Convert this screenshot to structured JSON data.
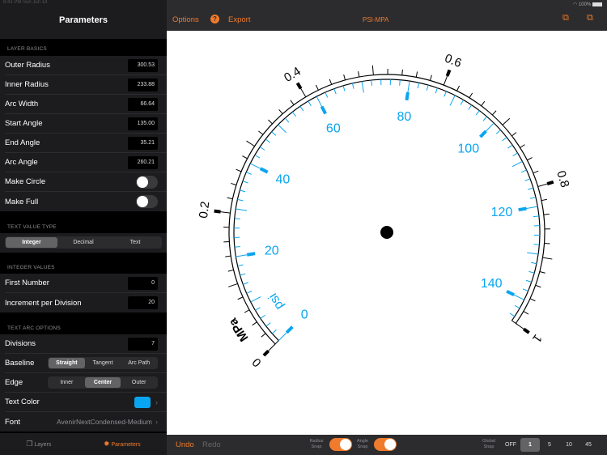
{
  "status": {
    "time": "8:41 PM  Sun Jun 14",
    "battery": "100%"
  },
  "sidebar": {
    "title": "Parameters",
    "layer_basics": {
      "header": "LAYER BASICS",
      "rows": [
        {
          "label": "Outer Radius",
          "value": "300.53"
        },
        {
          "label": "Inner Radius",
          "value": "233.88"
        },
        {
          "label": "Arc Width",
          "value": "66.64"
        },
        {
          "label": "Start Angle",
          "value": "135.00"
        },
        {
          "label": "End Angle",
          "value": "35.21"
        },
        {
          "label": "Arc Angle",
          "value": "260.21"
        }
      ],
      "make_circle": {
        "label": "Make Circle",
        "on": false
      },
      "make_full": {
        "label": "Make Full",
        "on": false
      }
    },
    "text_value_type": {
      "header": "TEXT VALUE TYPE",
      "options": [
        "Integer",
        "Decimal",
        "Text"
      ],
      "selected": "Integer"
    },
    "integer_values": {
      "header": "INTEGER VALUES",
      "rows": [
        {
          "label": "First Number",
          "value": "0"
        },
        {
          "label": "Increment per Division",
          "value": "20"
        }
      ]
    },
    "text_arc_options": {
      "header": "TEXT ARC OPTIONS",
      "divisions": {
        "label": "Divisions",
        "value": "7"
      },
      "baseline": {
        "label": "Baseline",
        "options": [
          "Straight",
          "Tangent",
          "Arc Path"
        ],
        "selected": "Straight"
      },
      "edge": {
        "label": "Edge",
        "options": [
          "Inner",
          "Center",
          "Outer"
        ],
        "selected": "Center"
      },
      "text_color": {
        "label": "Text Color",
        "color": "#0aa5f0"
      },
      "font": {
        "label": "Font",
        "value": "AvenirNextCondensed-Medium"
      }
    },
    "tabs": [
      {
        "label": "Layers",
        "icon": "layers-icon"
      },
      {
        "label": "Parameters",
        "icon": "gear-icon",
        "active": true
      }
    ]
  },
  "toolbar": {
    "options": "Options",
    "help": "?",
    "export": "Export",
    "title": "PSI-MPA"
  },
  "bottom": {
    "undo": "Undo",
    "redo": "Redo",
    "radius_snap": "Radius Snap",
    "angle_snap": "Angle Snap",
    "global_snap": "Global Snap",
    "snap_options": [
      "OFF",
      "1",
      "5",
      "10",
      "45"
    ],
    "snap_selected": "1"
  },
  "gauge": {
    "start_angle": 135,
    "sweep": 260.21,
    "mpa": {
      "unit": "MPa",
      "min": 0,
      "max": 1,
      "labels": [
        "0",
        "0.2",
        "0.4",
        "0.6",
        "0.8",
        "1"
      ],
      "minor_step": 0.02
    },
    "psi": {
      "unit": "psi",
      "max_for_sweep": 145.04,
      "labels": [
        "0",
        "20",
        "40",
        "60",
        "80",
        "100",
        "120",
        "140"
      ],
      "minor_step": 2
    },
    "colors": {
      "mpa": "#000000",
      "psi": "#0aa5f0",
      "accent": "#f07b2c"
    }
  }
}
